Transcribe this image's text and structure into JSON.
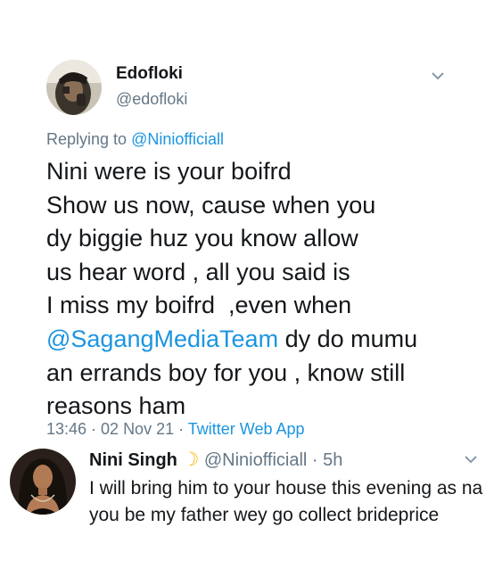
{
  "tweet": {
    "author_name": "Edofloki",
    "author_handle": "@edofloki",
    "replying_prefix": "Replying to ",
    "replying_to": "@Niniofficiall",
    "lines": [
      "Nini were is your boifrd",
      "Show us now, cause when you",
      "dy biggie huz you know allow",
      "us hear word , all you said is",
      "I miss my boifrd  ,even when"
    ],
    "mention_line": {
      "mention": "@SagangMediaTeam",
      "rest": " dy do mumu"
    },
    "lines_end": [
      "an errands boy for you , know still",
      "reasons ham"
    ],
    "timestamp": "13:46 · 02 Nov 21 · ",
    "source": "Twitter Web App",
    "menu_icon": "chevron-down-icon"
  },
  "reply": {
    "name": "Nini Singh",
    "emoji": "☽",
    "handle": "@Niniofficiall",
    "time_sep": " · ",
    "time": "5h",
    "text": "I will bring him to your house this evening as na you be my father wey go collect brideprice",
    "menu_icon": "chevron-down-icon"
  },
  "colors": {
    "link": "#1b95e0",
    "secondary_text": "#657786",
    "primary_text": "#14171a"
  }
}
